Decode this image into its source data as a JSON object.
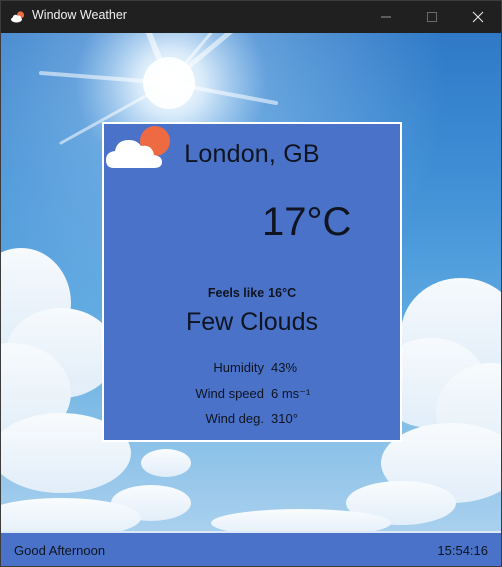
{
  "window": {
    "title": "Window Weather",
    "icon": "cloud-sun-icon",
    "controls": [
      "minimize-icon",
      "maximize-icon",
      "close-icon"
    ]
  },
  "weather": {
    "city": "London, GB",
    "temperature": "17°C",
    "condition_icon": "cloud-sun-icon",
    "feels_like_label": "Feels like",
    "feels_like_value": "16°C",
    "description": "Few Clouds",
    "details": [
      {
        "label": "Humidity",
        "value": "43%"
      },
      {
        "label": "Wind speed",
        "value": "6 ms⁻¹"
      },
      {
        "label": "Wind deg.",
        "value": "310°"
      }
    ]
  },
  "status": {
    "greeting": "Good Afternoon",
    "time": "15:54:16"
  },
  "colors": {
    "titlebar": "#202020",
    "card": "#4a72c9",
    "statusbar": "#4a72c9",
    "sun": "#ee6a43",
    "cloud": "#ffffff"
  }
}
